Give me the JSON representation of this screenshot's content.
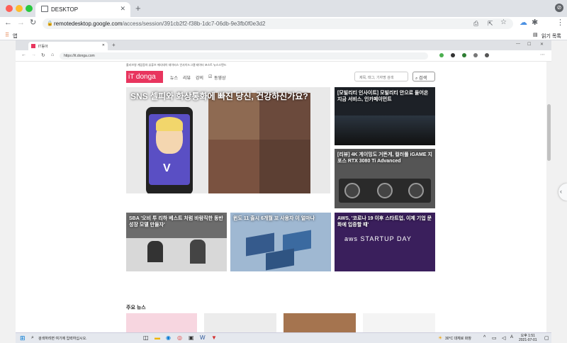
{
  "outer": {
    "tab_title": "DESKTOP",
    "url_host": "remotedesktop.google.com",
    "url_path": "/access/session/391cb2f2-f38b-1dc7-06db-9e3fb0f0e3d2",
    "bookmark_apps": "앱",
    "reading_list": "읽기 목록"
  },
  "inner": {
    "tab_title": "IT동아",
    "url": "https://it.donga.com"
  },
  "site": {
    "topline": "올리브영   게임동아   뷰튜브   에디데이   데이터스   인사이드그램   테이터 포스트   뉴스스텐드",
    "logo": "iT donga",
    "nav": [
      "뉴스",
      "리뷰",
      "강의",
      "동영상"
    ],
    "search_placeholder": "제목, 태그, 기자명 검색",
    "search_button": "검색",
    "featured_caption": "SNS 셀피와 화상통화에 빠진 당신, 건강하신가요?",
    "side_cards": [
      "[모빌리티 인사이트] 모빌리티 안으로 들어온 지금 서비스, 인카페이먼트",
      "[리뷰] 4K 게이밍도 거뜬게, 컬러풀 iGAME 지포스 RTX 3080 Ti Advanced"
    ],
    "row_cards": [
      "SBA '오비 투 리하 베스트 처럼 바람직한 동반 성장 모델 만들자'",
      "윈도 11 출시 6개월 꼬 사용자 이 얼마나",
      "AWS, '코로나 19 이후 스타트업, 이제 기업 문화에 입증할 때'"
    ],
    "aws_text": "aws STARTUP DAY",
    "section_title": "주요 뉴스"
  },
  "taskbar": {
    "search_placeholder": "검색하려면 여기에 입력하십시오.",
    "weather": "30°C 대체로 화창",
    "time": "오후 1:51",
    "date": "2021-07-01"
  },
  "colors": {
    "brand": "#e8355e",
    "chrome_bg": "#dee1e6"
  }
}
